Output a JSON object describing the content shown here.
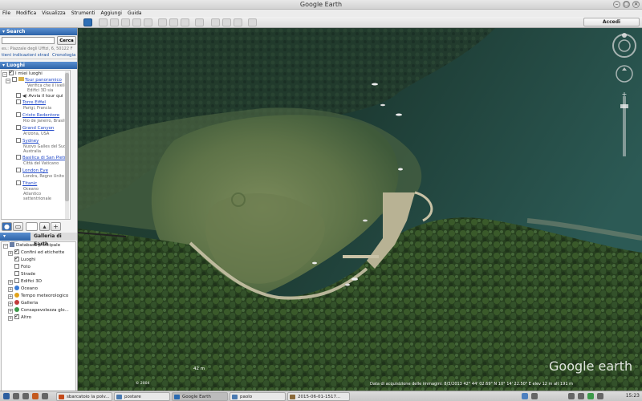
{
  "window": {
    "title": "Google Earth"
  },
  "menu": [
    "File",
    "Modifica",
    "Visualizza",
    "Strumenti",
    "Aggiungi",
    "Guida"
  ],
  "toolbar": {
    "accedi": "Accedi"
  },
  "search": {
    "header": "Search",
    "placeholder": "es.: Piazzale degli Uffizi, 6, 50122 F",
    "button": "Cerca",
    "tabs": [
      "tieni indicazioni strad",
      "Cronologia"
    ]
  },
  "places": {
    "header": "Luoghi",
    "root": "I miei luoghi",
    "items": [
      {
        "label": "Tour panoramico",
        "sub": "Verifica che il livello Edifici 3D sia",
        "checked": false
      },
      {
        "label": "Avvia il tour qui",
        "sub": "",
        "checked": false
      },
      {
        "label": "Torre Eiffel",
        "sub": "Parigi, Francia",
        "checked": false
      },
      {
        "label": "Cristo Redentore",
        "sub": "Rio de Janeiro, Brasile",
        "checked": false
      },
      {
        "label": "Grand Canyon",
        "sub": "Arizona, USA",
        "checked": false
      },
      {
        "label": "Sydney",
        "sub": "Nuovo Galles del Sud, Australia",
        "checked": false
      },
      {
        "label": "Basilica di San Pietro",
        "sub": "Città del Vaticano",
        "checked": false
      },
      {
        "label": "London Eye",
        "sub": "Londra, Regno Unito",
        "checked": false
      },
      {
        "label": "Titanic",
        "sub": "Oceano Atlantico settentrionale",
        "checked": false
      }
    ]
  },
  "layers": {
    "tabs": [
      "Livelli",
      "Galleria di Earth"
    ],
    "root": "Database principale",
    "items": [
      {
        "label": "Confini ed etichette",
        "checked": true
      },
      {
        "label": "Luoghi",
        "checked": true
      },
      {
        "label": "Foto",
        "checked": false
      },
      {
        "label": "Strade",
        "checked": false
      },
      {
        "label": "Edifici 3D",
        "checked": false
      },
      {
        "label": "Oceano",
        "checked": false
      },
      {
        "label": "Tempo meteorologico",
        "checked": false
      },
      {
        "label": "Galleria",
        "checked": false
      },
      {
        "label": "Consapevolezza glo...",
        "checked": false
      },
      {
        "label": "Altro",
        "checked": true
      }
    ]
  },
  "map": {
    "logo": "Google earth",
    "status": "Data di acquisizione delle immagini: 8/3/2013   42° 44' 02.69\" N   10° 14' 22.50\" E   elev    12 m    alt    191 m",
    "scale": "42 m",
    "year": "© 2004"
  },
  "taskbar": {
    "items": [
      "sbarcatoio la polv...",
      "postare",
      "Google Earth",
      "paolo",
      "2015-06-01-1517..."
    ],
    "active": 2,
    "clock": "15:23"
  }
}
